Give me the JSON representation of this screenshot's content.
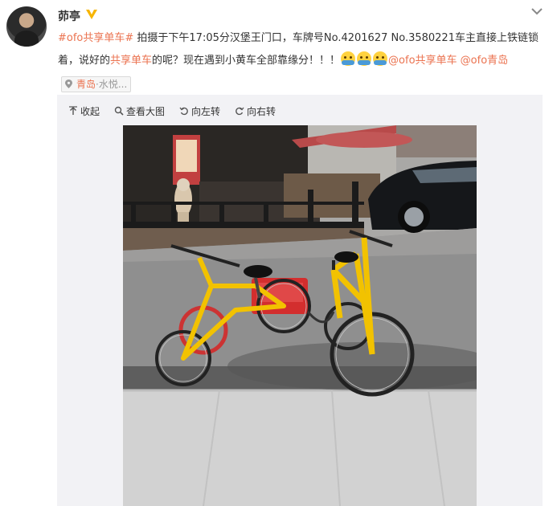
{
  "user": {
    "name": "茆亭",
    "verified_icon": "yellow-v-verified-icon"
  },
  "post": {
    "topic": "#ofo共享单车#",
    "text_1": " 拍摄于下午17:05分汉堡王门口，车牌号No.4201627 No.3580221车主直接上铁链锁着，说好的",
    "link_shared": "共享单车",
    "text_2": "的呢？现在遇到小黄车全部靠缘分！！！",
    "emoji_icon": "hug-emoji-icon",
    "mention_1": "@ofo共享单车",
    "mention_2": "@ofo青岛",
    "location_city": "青岛",
    "location_sep": "·",
    "location_place": "水悦...",
    "location_icon": "map-pin-icon"
  },
  "toolbar": {
    "collapse": "收起",
    "view_large": "查看大图",
    "rotate_left": "向左转",
    "rotate_right": "向右转"
  },
  "icons": {
    "chevron": "chevron-down-icon",
    "collapse": "arrow-up-icon",
    "view_large": "magnifier-icon",
    "rotate_left": "rotate-left-icon",
    "rotate_right": "rotate-right-icon"
  },
  "photo": {
    "subject": "two yellow ofo bicycles chained together on a sidewalk"
  },
  "colors": {
    "accent": "#eb7350",
    "bike_yellow": "#f2c200",
    "panel": "#f2f2f5"
  }
}
